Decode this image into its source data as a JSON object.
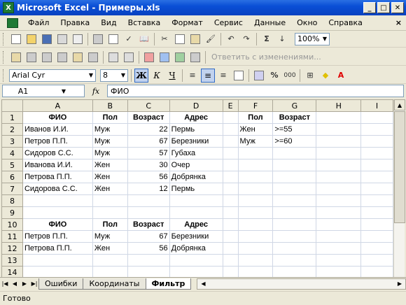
{
  "window": {
    "title": "Microsoft Excel - Примеры.xls",
    "app_icon": "X"
  },
  "menu": [
    "Файл",
    "Правка",
    "Вид",
    "Вставка",
    "Формат",
    "Сервис",
    "Данные",
    "Окно",
    "Справка"
  ],
  "menu_close": "×",
  "toolbar": {
    "zoom": "100%",
    "sigma": "Σ",
    "changes_label": "Ответить с изменениями..."
  },
  "format": {
    "font": "Arial Cyr",
    "size": "8",
    "bold": "Ж",
    "italic": "К",
    "underline": "Ч",
    "percent": "%",
    "thousand": "000"
  },
  "formula": {
    "cell_ref": "A1",
    "fx": "fx",
    "value": "ФИО"
  },
  "columns": [
    "A",
    "B",
    "C",
    "D",
    "E",
    "F",
    "G",
    "H",
    "I"
  ],
  "rows": [
    "1",
    "2",
    "3",
    "4",
    "5",
    "6",
    "7",
    "8",
    "9",
    "10",
    "11",
    "12",
    "13",
    "14"
  ],
  "table1": {
    "headers": [
      "ФИО",
      "Пол",
      "Возраст",
      "Адрес"
    ],
    "rows": [
      [
        "Иванов И.И.",
        "Муж",
        "22",
        "Пермь"
      ],
      [
        "Петров П.П.",
        "Муж",
        "67",
        "Березники"
      ],
      [
        "Сидоров С.С.",
        "Муж",
        "57",
        "Губаха"
      ],
      [
        "Иванова И.И.",
        "Жен",
        "30",
        "Очер"
      ],
      [
        "Петрова П.П.",
        "Жен",
        "56",
        "Добрянка"
      ],
      [
        "Сидорова С.С.",
        "Жен",
        "12",
        "Пермь"
      ]
    ]
  },
  "criteria": {
    "headers": [
      "Пол",
      "Возраст"
    ],
    "rows": [
      [
        "Жен",
        ">=55"
      ],
      [
        "Муж",
        ">=60"
      ]
    ]
  },
  "table2": {
    "headers": [
      "ФИО",
      "Пол",
      "Возраст",
      "Адрес"
    ],
    "rows": [
      [
        "Петров П.П.",
        "Муж",
        "67",
        "Березники"
      ],
      [
        "Петрова П.П.",
        "Жен",
        "56",
        "Добрянка"
      ]
    ]
  },
  "sheets": [
    "Ошибки",
    "Координаты",
    "Фильтр"
  ],
  "active_sheet": "Фильтр",
  "status": "Готово"
}
